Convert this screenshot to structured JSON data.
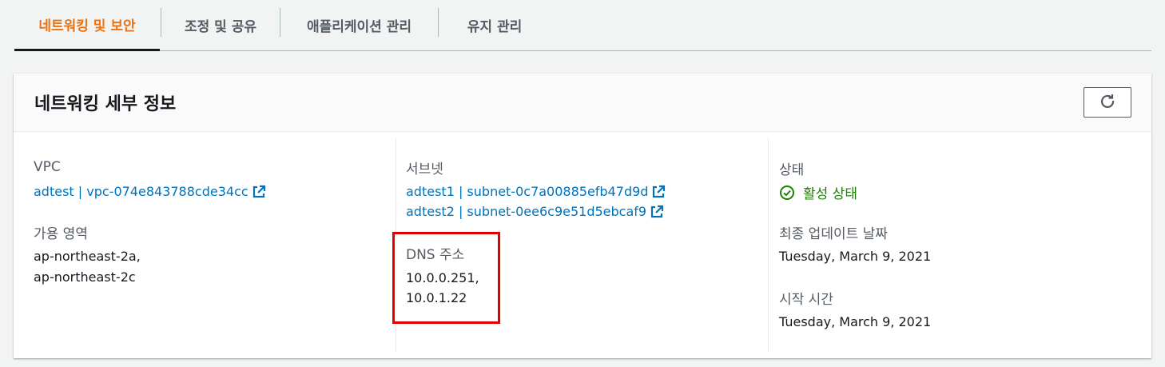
{
  "tabs": [
    {
      "label": "네트워킹 및 보안",
      "active": true
    },
    {
      "label": "조정 및 공유",
      "active": false
    },
    {
      "label": "애플리케이션 관리",
      "active": false
    },
    {
      "label": "유지 관리",
      "active": false
    }
  ],
  "panel": {
    "title": "네트워킹 세부 정보",
    "refresh_icon": "refresh-icon"
  },
  "col1": {
    "vpc_label": "VPC",
    "vpc_link": "adtest | vpc-074e843788cde34cc",
    "az_label": "가용 영역",
    "az_line1": "ap-northeast-2a,",
    "az_line2": "ap-northeast-2c"
  },
  "col2": {
    "subnet_label": "서브넷",
    "subnet_links": [
      "adtest1 | subnet-0c7a00885efb47d9d",
      "adtest2 | subnet-0ee6c9e51d5ebcaf9"
    ],
    "dns_label": "DNS 주소",
    "dns_line1": "10.0.0.251,",
    "dns_line2": "10.0.1.22"
  },
  "col3": {
    "status_label": "상태",
    "status_value": "활성 상태",
    "updated_label": "최종 업데이트 날짜",
    "updated_value": "Tuesday, March 9, 2021",
    "start_label": "시작 시간",
    "start_value": "Tuesday, March 9, 2021"
  },
  "colors": {
    "accent": "#ec7211",
    "link": "#0073bb",
    "success": "#1d8102",
    "highlight": "#e00000"
  }
}
